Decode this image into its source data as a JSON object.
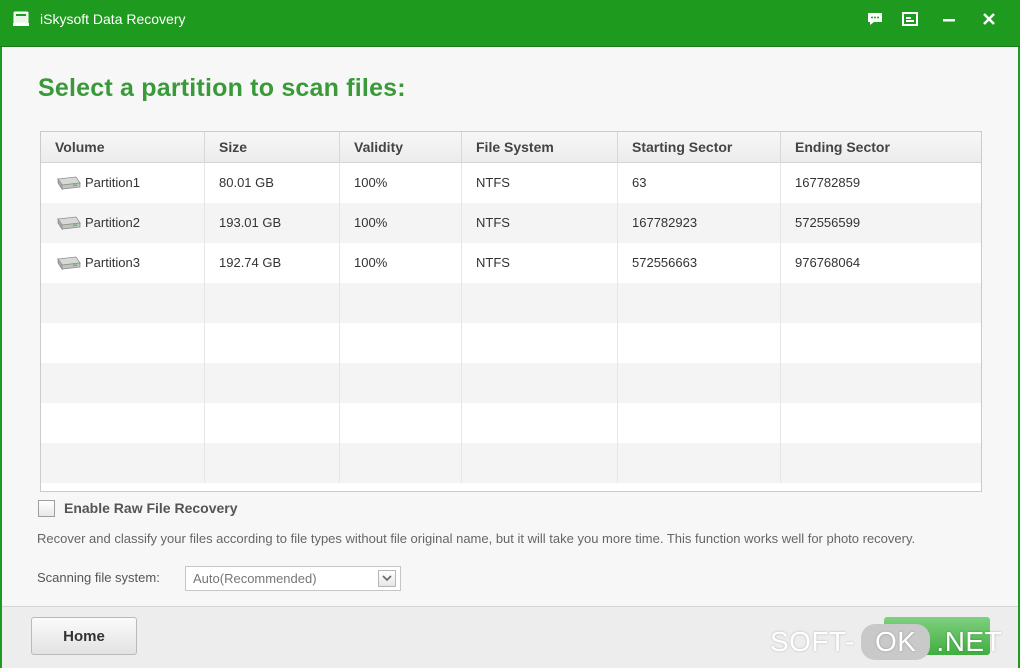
{
  "window": {
    "title": "iSkysoft Data Recovery",
    "icons": [
      "drive-icon",
      "feedback-icon",
      "register-icon",
      "minimize-icon",
      "close-icon"
    ]
  },
  "page": {
    "heading": "Select a partition to scan files:"
  },
  "table": {
    "columns": [
      "Volume",
      "Size",
      "Validity",
      "File System",
      "Starting Sector",
      "Ending Sector"
    ],
    "rows": [
      {
        "volume": "Partition1",
        "size": "80.01 GB",
        "validity": "100%",
        "file_system": "NTFS",
        "start": "63",
        "end": "167782859"
      },
      {
        "volume": "Partition2",
        "size": "193.01 GB",
        "validity": "100%",
        "file_system": "NTFS",
        "start": "167782923",
        "end": "572556599"
      },
      {
        "volume": "Partition3",
        "size": "192.74 GB",
        "validity": "100%",
        "file_system": "NTFS",
        "start": "572556663",
        "end": "976768064"
      }
    ]
  },
  "raw_recovery": {
    "label": "Enable Raw File Recovery",
    "checked": false,
    "description": "Recover and classify your files according to file types without file original name, but it will take you more time. This function works well for photo recovery."
  },
  "scan": {
    "label": "Scanning file system:",
    "selected": "Auto(Recommended)"
  },
  "footer": {
    "home_label": "Home"
  },
  "watermark": {
    "left": "SOFT-",
    "mid": "OK",
    "right": ".NET"
  },
  "colors": {
    "brand": "#1e9a1e",
    "heading": "#3a9a3a",
    "alt_row": "#f4f4f4"
  }
}
